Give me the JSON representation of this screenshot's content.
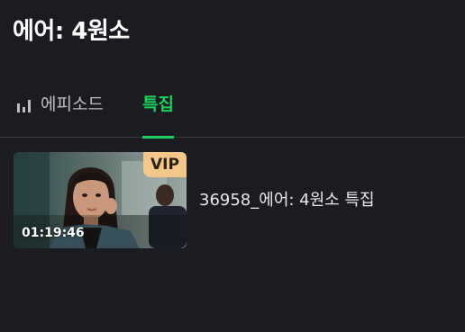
{
  "header": {
    "title": "에어: 4원소"
  },
  "tabs": [
    {
      "label": "에피소드",
      "icon": "bar-chart-icon",
      "active": false
    },
    {
      "label": "특집",
      "active": true
    }
  ],
  "colors": {
    "accent": "#1ecf5b",
    "vip": "#f3c68a",
    "background": "#1b1c21"
  },
  "videos": [
    {
      "title": "36958_에어: 4원소 특집",
      "badge": "VIP",
      "duration": "01:19:46"
    }
  ]
}
